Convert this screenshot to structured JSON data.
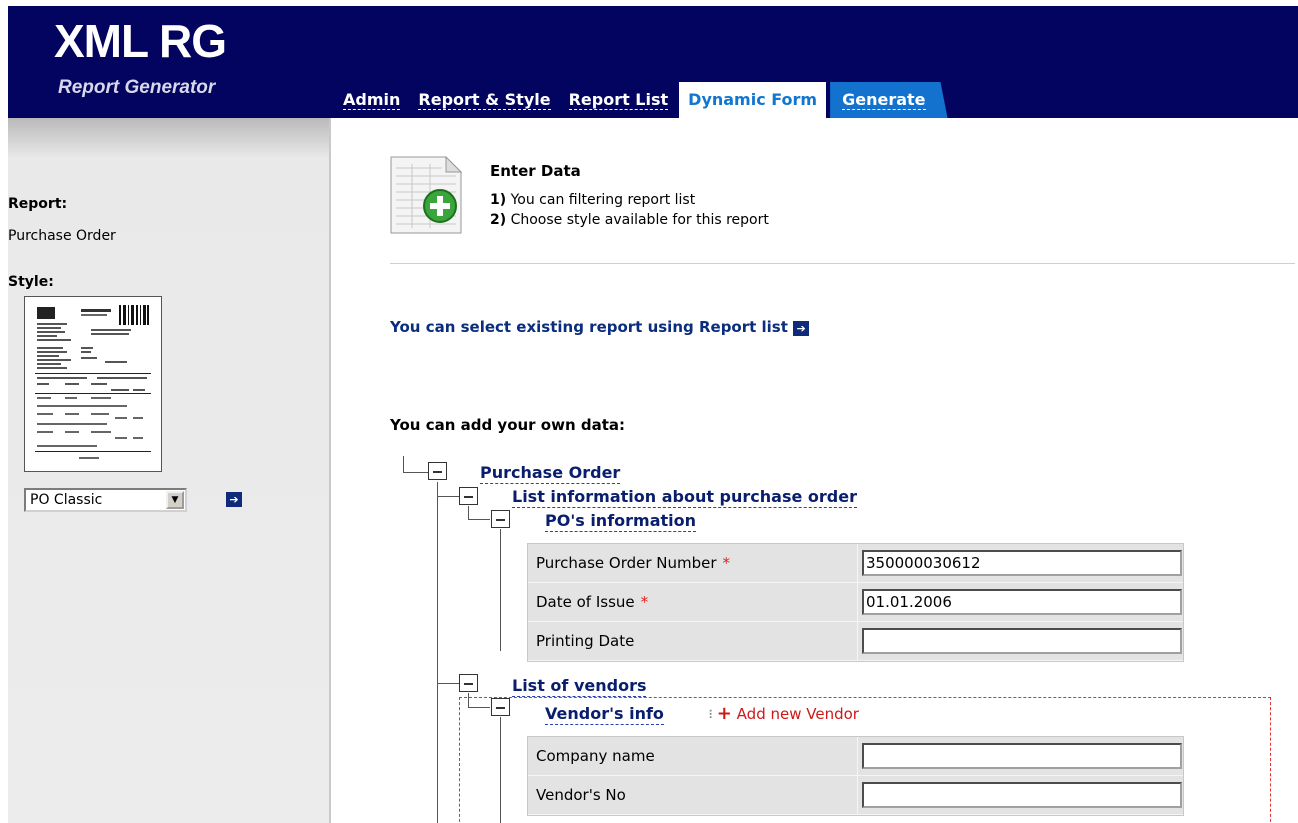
{
  "header": {
    "logo_title": "XML RG",
    "logo_subtitle": "Report Generator",
    "bg_color": "#020460"
  },
  "tabs": [
    {
      "label": "Admin",
      "active": false
    },
    {
      "label": "Report & Style",
      "active": false
    },
    {
      "label": "Report List",
      "active": false
    },
    {
      "label": "Dynamic Form",
      "active": true
    },
    {
      "label": "Generate",
      "active": false
    }
  ],
  "sidebar": {
    "report_label": "Report:",
    "report_value": "Purchase Order",
    "style_label": "Style:",
    "style_selected": "PO Classic",
    "go_icon": "arrow-right-icon"
  },
  "main": {
    "enter_title": "Enter Data",
    "steps": [
      {
        "num": "1)",
        "text": "You can filtering report list"
      },
      {
        "num": "2)",
        "text": "Choose style available for this report"
      }
    ],
    "existing_link": "You can select existing report using Report list",
    "add_own": "You can add your own data:"
  },
  "tree": {
    "root": "Purchase Order",
    "po_info_group": "List information about purchase order",
    "po_info": "PO's information",
    "po_fields": [
      {
        "label": "Purchase Order Number",
        "required": true,
        "value": "350000030612"
      },
      {
        "label": "Date of Issue",
        "required": true,
        "value": "01.01.2006"
      },
      {
        "label": "Printing Date",
        "required": false,
        "value": ""
      }
    ],
    "vendors_group": "List of vendors",
    "vendor_info": "Vendor's info",
    "add_vendor": "Add new Vendor",
    "vendor_fields": [
      {
        "label": "Company name",
        "value": ""
      },
      {
        "label": "Vendor's No",
        "value": ""
      }
    ]
  },
  "required_marker": "*",
  "colors": {
    "tab_active_text": "#1276d0",
    "generate_tab_bg": "#1272ce",
    "link_text": "#0a2d7d",
    "required": "#e02020"
  }
}
